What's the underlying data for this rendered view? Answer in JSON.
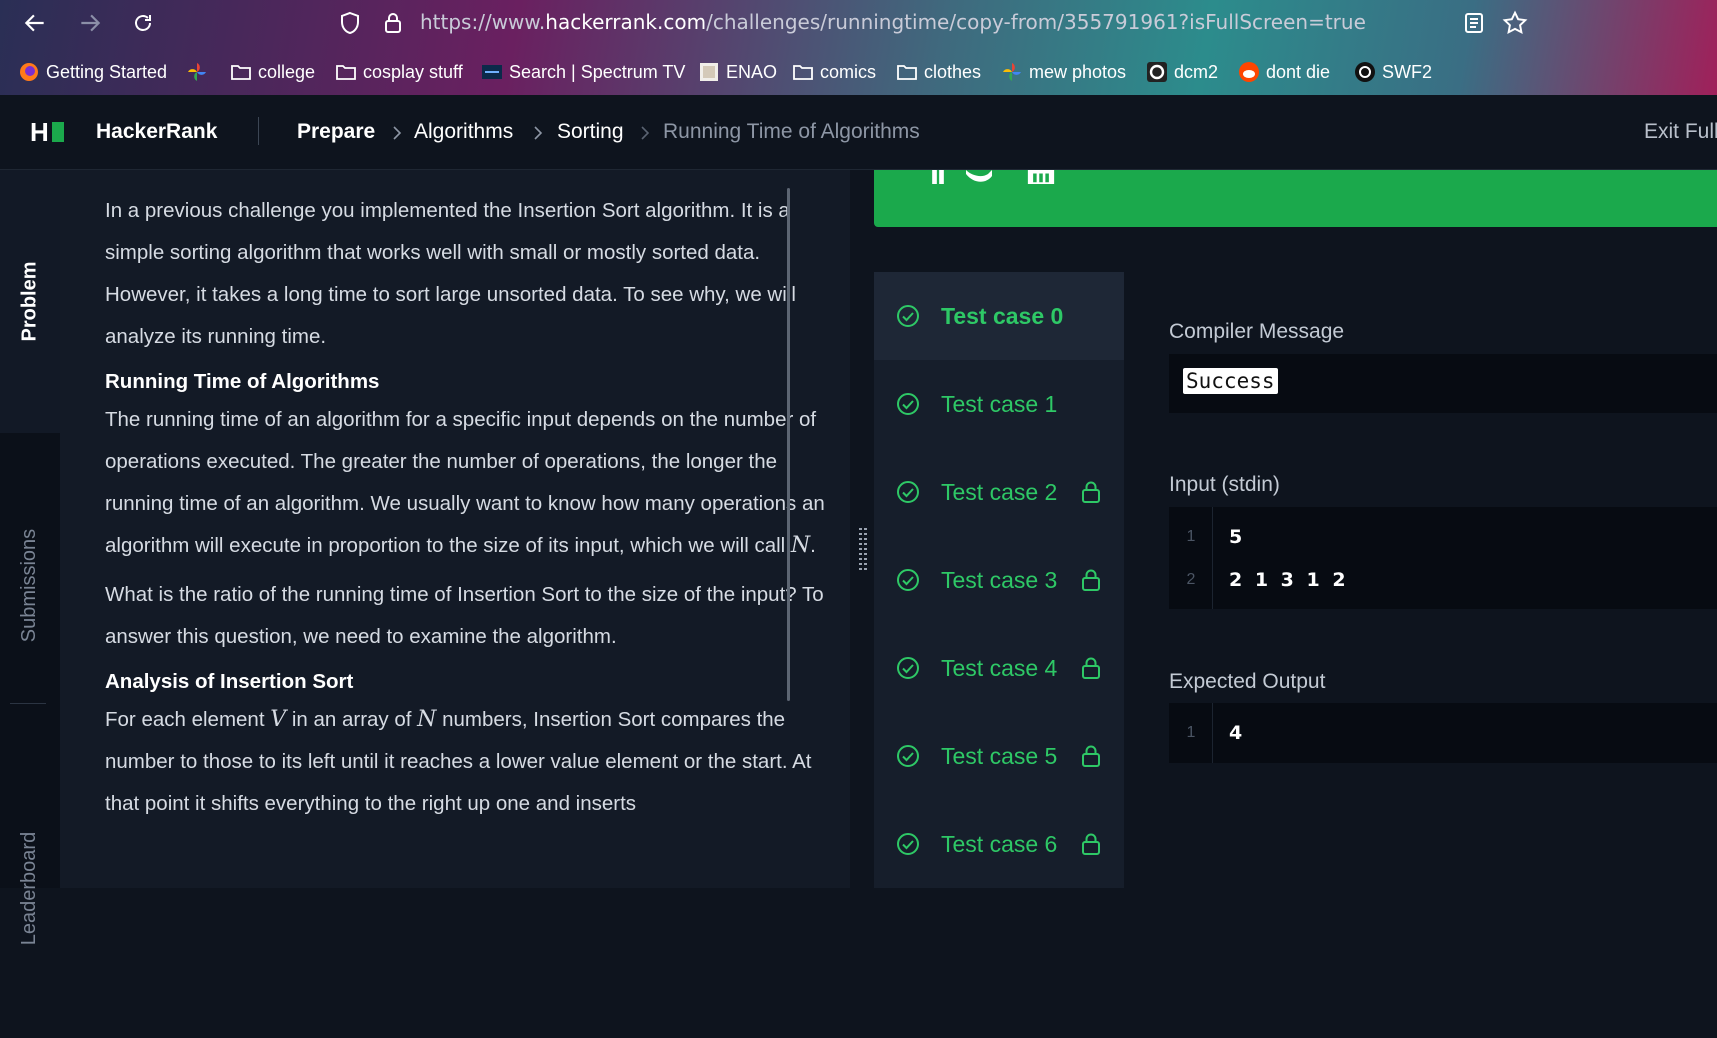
{
  "browser": {
    "url_prefix": "https://www.",
    "url_host": "hackerrank.com",
    "url_path": "/challenges/runningtime/copy-from/355791961?isFullScreen=true",
    "bookmarks": [
      {
        "label": "Getting Started",
        "icon": "firefox-icon"
      },
      {
        "label": "",
        "icon": "pinwheel-icon"
      },
      {
        "label": "college",
        "icon": "folder-icon"
      },
      {
        "label": "cosplay stuff",
        "icon": "folder-icon"
      },
      {
        "label": "Search | Spectrum TV",
        "icon": "spectrum-icon"
      },
      {
        "label": "ENAO",
        "icon": "enao-icon"
      },
      {
        "label": "comics",
        "icon": "folder-icon"
      },
      {
        "label": "clothes",
        "icon": "folder-icon"
      },
      {
        "label": "mew photos",
        "icon": "pinwheel-icon"
      },
      {
        "label": "dcm2",
        "icon": "a-icon"
      },
      {
        "label": "dont die",
        "icon": "reddit-icon"
      },
      {
        "label": "SWF2",
        "icon": "swirl-icon"
      }
    ]
  },
  "header": {
    "brand": "HackerRank",
    "breadcrumbs": [
      "Prepare",
      "Algorithms",
      "Sorting",
      "Running Time of Algorithms"
    ],
    "exit": "Exit Full"
  },
  "tabs": {
    "problem": "Problem",
    "submissions": "Submissions",
    "leaderboard": "Leaderboard"
  },
  "problem": {
    "p1": "In a previous challenge you implemented the Insertion Sort algorithm. It is a simple sorting algorithm that works well with small or mostly sorted data. However, it takes a long time to sort large unsorted data. To see why, we will analyze its running time.",
    "h1": "Running Time of Algorithms",
    "p2": "The running time of an algorithm for a specific input depends on the number of operations executed. The greater the number of operations, the longer the running time of an algorithm. We usually want to know how many operations an algorithm will execute in proportion to the size of its input, which we will call ",
    "p2_math": "N",
    "p2_end": ".",
    "p3": "What is the ratio of the running time of Insertion Sort to the size of the input? To answer this question, we need to examine the algorithm.",
    "h2": "Analysis of Insertion Sort",
    "p4_a": "For each element ",
    "p4_m1": "V",
    "p4_b": " in an array of ",
    "p4_m2": "N",
    "p4_c": " numbers, Insertion Sort compares the number to those to its left until it reaches a lower value element or the start. At that point it shifts everything to the right up one and inserts"
  },
  "test_cases": [
    {
      "label": "Test case 0",
      "locked": false,
      "active": true
    },
    {
      "label": "Test case 1",
      "locked": false,
      "active": false
    },
    {
      "label": "Test case 2",
      "locked": true,
      "active": false
    },
    {
      "label": "Test case 3",
      "locked": true,
      "active": false
    },
    {
      "label": "Test case 4",
      "locked": true,
      "active": false
    },
    {
      "label": "Test case 5",
      "locked": true,
      "active": false
    },
    {
      "label": "Test case 6",
      "locked": true,
      "active": false
    }
  ],
  "result": {
    "compiler_title": "Compiler Message",
    "compiler_message": "Success",
    "input_title": "Input (stdin)",
    "input_lines": [
      {
        "n": "1",
        "text": "5"
      },
      {
        "n": "2",
        "text": "2 1 3 1 2"
      }
    ],
    "output_title": "Expected Output",
    "output_lines": [
      {
        "n": "1",
        "text": "4"
      }
    ]
  },
  "colors": {
    "accent_green": "#1ba94c",
    "pass_green": "#2ec866"
  }
}
